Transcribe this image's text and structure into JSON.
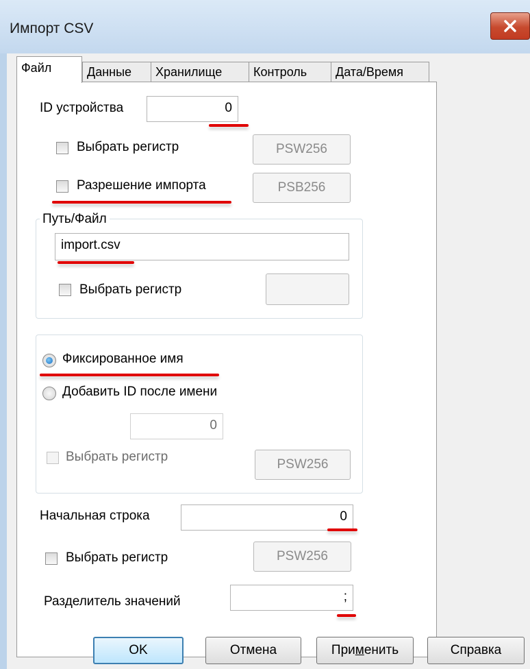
{
  "window": {
    "title": "Импорт CSV"
  },
  "tabs": [
    {
      "label": "Файл",
      "active": true
    },
    {
      "label": "Данные",
      "active": false
    },
    {
      "label": "Хранилище",
      "active": false
    },
    {
      "label": "Контроль",
      "active": false
    },
    {
      "label": "Дата/Время",
      "active": false
    }
  ],
  "device_id": {
    "label": "ID устройства",
    "value": "0"
  },
  "select_register_1": {
    "label": "Выбрать регистр",
    "button": "PSW256"
  },
  "import_permission": {
    "label": "Разрешение импорта",
    "button": "PSB256"
  },
  "path_group": {
    "title": "Путь/Файл",
    "file_value": "import.csv",
    "select_register_label": "Выбрать регистр",
    "button": ""
  },
  "name_group": {
    "fixed_name_label": "Фиксированное имя",
    "add_id_label": "Добавить ID после имени",
    "id_value": "0",
    "select_register_label": "Выбрать регистр",
    "button": "PSW256"
  },
  "start_row": {
    "label": "Начальная строка",
    "value": "0"
  },
  "select_register_2": {
    "label": "Выбрать регистр",
    "button": "PSW256"
  },
  "separator": {
    "label": "Разделитель значений",
    "value": ";"
  },
  "buttons": {
    "ok": "OK",
    "cancel": "Отмена",
    "apply_pre": "При",
    "apply_mnemonic": "м",
    "apply_post": "енить",
    "help": "Справка"
  },
  "colors": {
    "annotation_underline": "#e00000",
    "radio_selected": "#1a6fc4"
  }
}
